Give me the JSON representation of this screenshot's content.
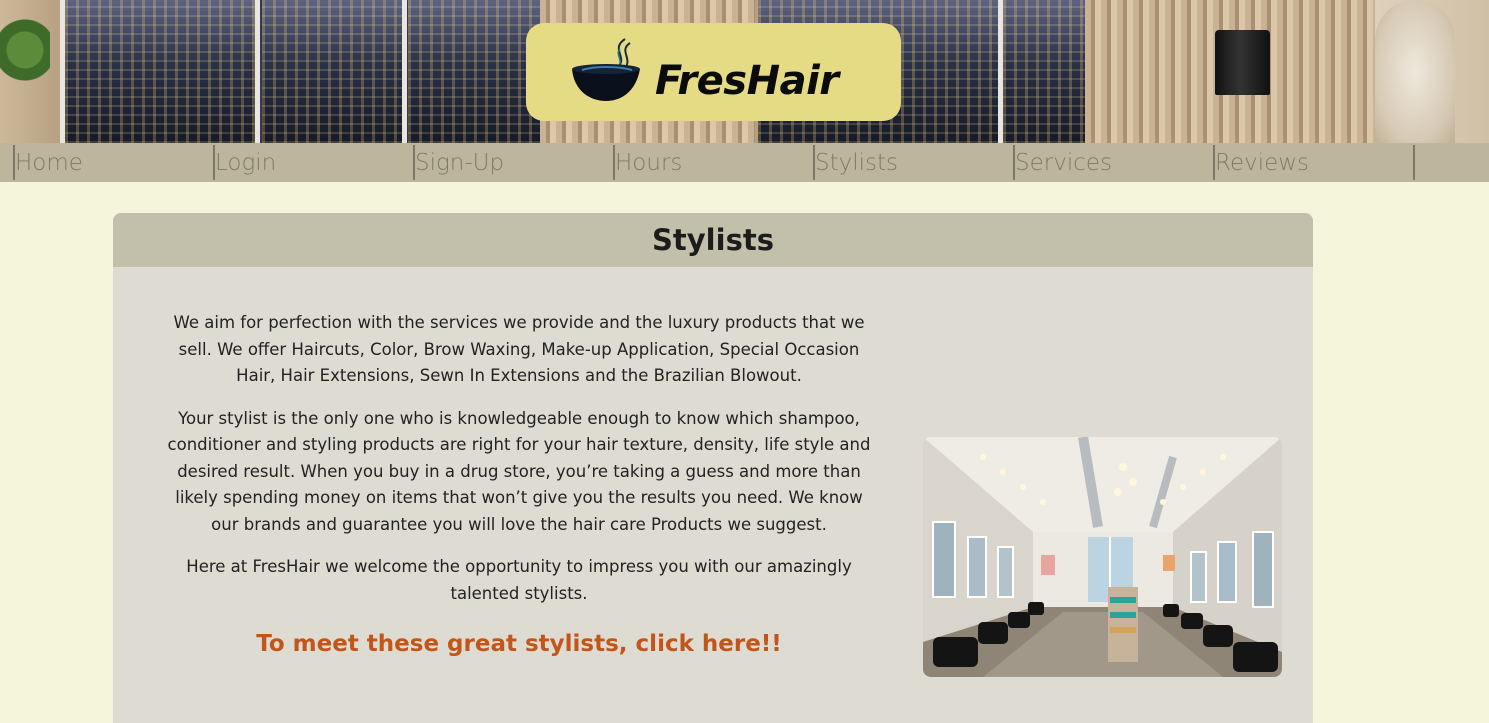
{
  "brand": {
    "name": "FresHair",
    "logo_icon": "hair-cup-icon",
    "logo_bg": "#e5db85"
  },
  "nav": {
    "items": [
      {
        "label": "Home"
      },
      {
        "label": "Login"
      },
      {
        "label": "Sign-Up"
      },
      {
        "label": "Hours"
      },
      {
        "label": "Stylists"
      },
      {
        "label": "Services"
      },
      {
        "label": "Reviews"
      }
    ]
  },
  "section": {
    "title": "Stylists",
    "paragraphs": [
      "We aim for perfection with the services we provide and the luxury products that we sell. We offer Haircuts, Color, Brow Waxing, Make-up Application, Special Occasion Hair, Hair Extensions, Sewn In Extensions and the Brazilian Blowout.",
      "Your stylist is the only one who is knowledgeable enough to know which shampoo, conditioner and styling products are right for your hair texture, density, life style and desired result. When you buy in a drug store, you’re taking a guess and more than likely spending money on items that won’t give you the results you need. We know our brands and guarantee you will love the hair care Products we suggest.",
      "Here at FresHair we welcome the opportunity to impress you with our amazingly talented stylists."
    ],
    "cta": "To meet these great stylists, click here!!"
  },
  "colors": {
    "page_bg": "#f5f5dc",
    "nav_bg": "#bdb69d",
    "card_bg": "#dedbd2",
    "card_header_bg": "#c2bfab",
    "cta": "#c2561a"
  }
}
